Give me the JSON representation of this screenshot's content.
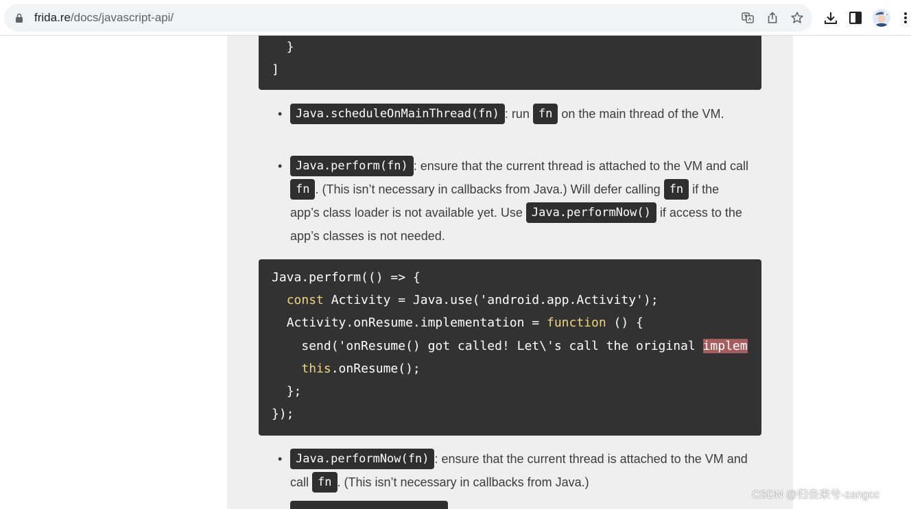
{
  "browser": {
    "url_host": "frida.re",
    "url_path": "/docs/javascript-api/",
    "icons": [
      "lock-icon",
      "translate-icon",
      "share-icon",
      "bookmark-star-icon",
      "download-icon",
      "side-panel-icon",
      "profile-avatar",
      "menu-kebab-icon"
    ]
  },
  "code_top": {
    "lines": [
      "  }",
      "]"
    ]
  },
  "item1": {
    "code1": "Java.scheduleOnMainThread(fn)",
    "text1": ": run ",
    "code2": "fn",
    "text2": " on the main thread of the VM."
  },
  "item2": {
    "code1": "Java.perform(fn)",
    "text1": ": ensure that the current thread is attached to the VM and call ",
    "code2": "fn",
    "text2": ". (This isn’t necessary in callbacks from Java.) Will defer calling ",
    "code3": "fn",
    "text3": " if the app’s class loader is not available yet. Use ",
    "code4": "Java.performNow()",
    "text4": " if access to the app’s classes is not needed."
  },
  "code_example": {
    "line1": "Java.perform(() => {",
    "line2_kw": "const",
    "line2_rest": " Activity = Java.use('android.app.Activity');",
    "line3_pre": "Activity.onResume.implementation = ",
    "line3_kw": "function",
    "line3_post": " () {",
    "line4_pre": "send('onResume() got called! Let\\'s call the original ",
    "line4_hl": "implem",
    "line5_kw": "this",
    "line5_rest": ".onResume();",
    "line6": "};",
    "line7": "});"
  },
  "item3": {
    "code1": "Java.performNow(fn)",
    "text1": ": ensure that the current thread is attached to the VM and call ",
    "code2": "fn",
    "text2": ". (This isn’t necessary in callbacks from Java.)"
  },
  "watermark": "CSDN @归去来兮-zangcc",
  "colors": {
    "code_bg": "#323232",
    "keyword": "#f0d47e",
    "highlight": "#a65d5d",
    "page_bg": "#efefef"
  }
}
